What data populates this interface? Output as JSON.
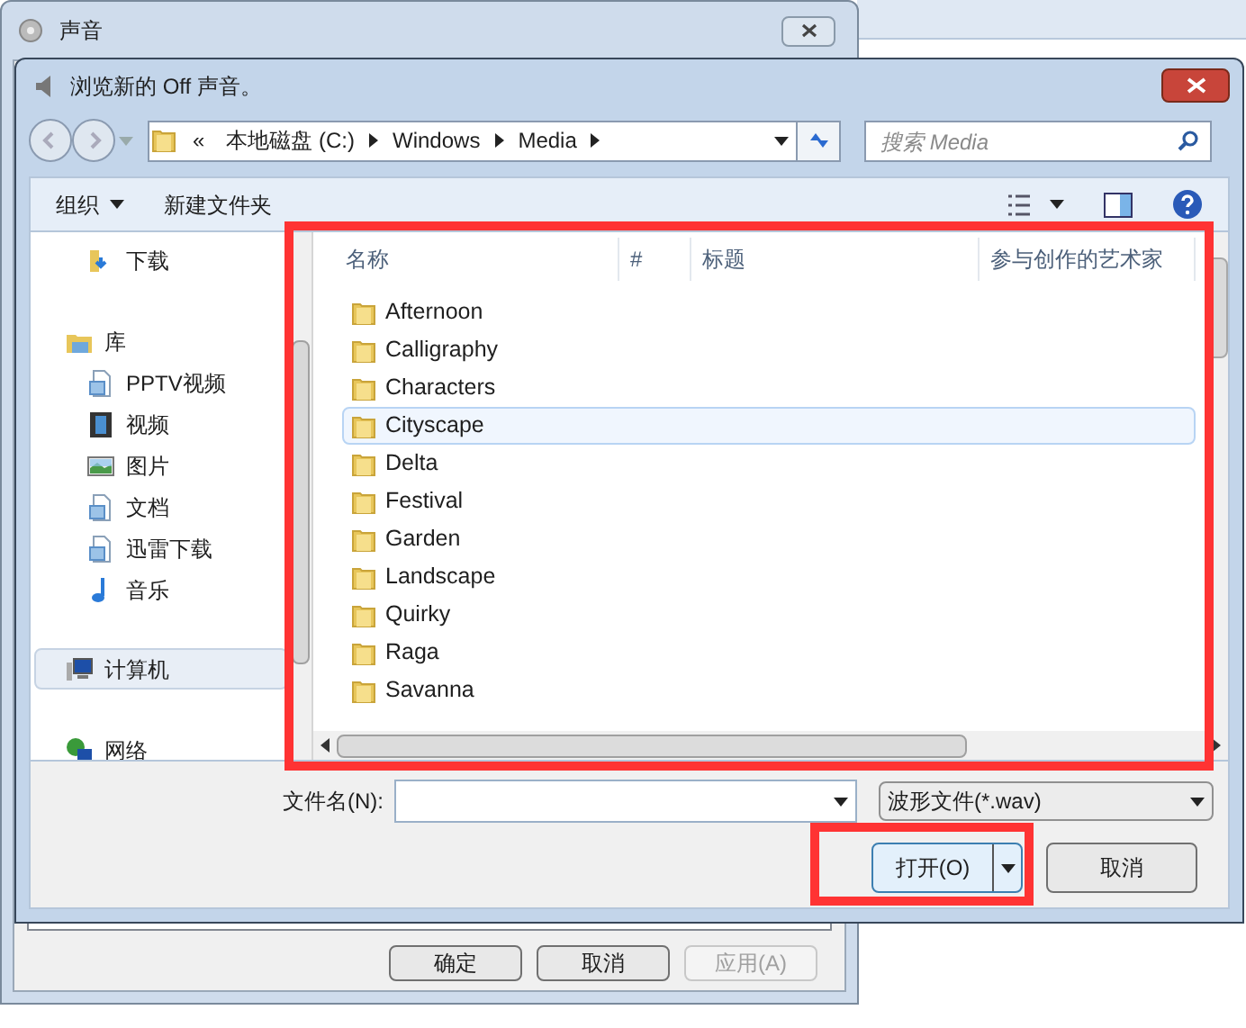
{
  "back_window": {
    "title": "声音",
    "buttons": [
      {
        "label": "确定",
        "disabled": false
      },
      {
        "label": "取消",
        "disabled": false
      },
      {
        "label": "应用(A)",
        "disabled": true
      }
    ]
  },
  "dialog": {
    "title": "浏览新的 Off 声音。",
    "breadcrumb": [
      "本地磁盘 (C:)",
      "Windows",
      "Media"
    ],
    "breadcrumb_overflow": "«",
    "search": {
      "placeholder": "搜索 Media"
    },
    "toolbar": [
      {
        "label": "组织",
        "kind": "menu"
      },
      {
        "label": "新建文件夹",
        "kind": "button"
      }
    ],
    "nav": [
      {
        "label": "下载",
        "kind": "download",
        "selected": false
      },
      {
        "label": "库",
        "kind": "library",
        "selected": false,
        "children": [
          {
            "label": "PPTV视频",
            "kind": "doc",
            "selected": false
          },
          {
            "label": "视频",
            "kind": "video",
            "selected": false
          },
          {
            "label": "图片",
            "kind": "picture",
            "selected": false
          },
          {
            "label": "文档",
            "kind": "doc",
            "selected": false
          },
          {
            "label": "迅雷下载",
            "kind": "doc",
            "selected": false
          },
          {
            "label": "音乐",
            "kind": "music",
            "selected": false
          }
        ]
      },
      {
        "label": "计算机",
        "kind": "computer",
        "selected": true
      },
      {
        "label": "网络",
        "kind": "network",
        "selected": false
      }
    ],
    "columns": [
      "名称",
      "#",
      "标题",
      "参与创作的艺术家"
    ],
    "files": [
      {
        "name": "Afternoon",
        "selected": false
      },
      {
        "name": "Calligraphy",
        "selected": false
      },
      {
        "name": "Characters",
        "selected": false
      },
      {
        "name": "Cityscape",
        "selected": true
      },
      {
        "name": "Delta",
        "selected": false
      },
      {
        "name": "Festival",
        "selected": false
      },
      {
        "name": "Garden",
        "selected": false
      },
      {
        "name": "Landscape",
        "selected": false
      },
      {
        "name": "Quirky",
        "selected": false
      },
      {
        "name": "Raga",
        "selected": false
      },
      {
        "name": "Savanna",
        "selected": false
      }
    ],
    "filename_label": "文件名(N):",
    "filetype": "波形文件(*.wav)",
    "open_button": "打开(O)",
    "cancel_button": "取消"
  },
  "annotations": [
    {
      "kind": "frame"
    },
    {
      "kind": "frame"
    }
  ]
}
